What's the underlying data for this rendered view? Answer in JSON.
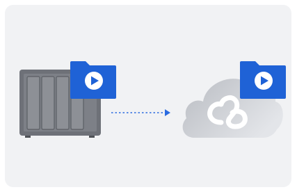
{
  "illustration": {
    "source": {
      "device": "nas-server",
      "badge_icon": "video-folder-icon"
    },
    "transfer": {
      "direction": "source-to-destination",
      "style": "dotted-arrow"
    },
    "destination": {
      "device": "cloud-storage",
      "logo_icon": "c2-cloud-logo-icon",
      "badge_icon": "video-folder-icon"
    }
  },
  "colors": {
    "card_background": "#f1f2f4",
    "nas_body": "#6e7178",
    "nas_bays": "#8a8d93",
    "folder_blue": "#1f62d6",
    "arrow_blue": "#2a6be0",
    "cloud_light": "#dfe1e5",
    "cloud_dark": "#b9bcc2"
  }
}
